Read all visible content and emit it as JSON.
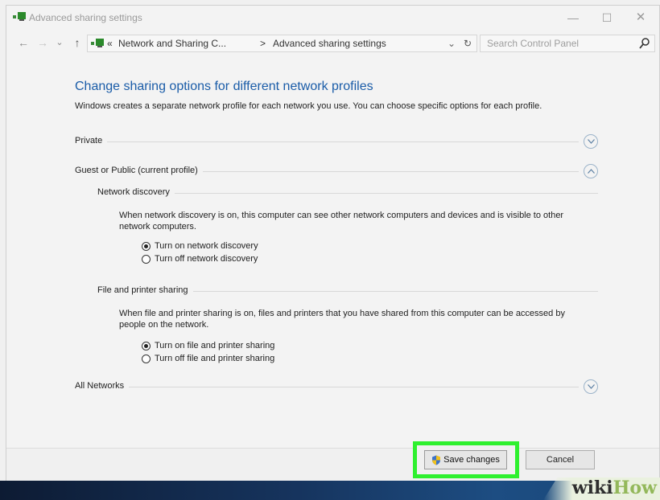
{
  "window": {
    "title": "Advanced sharing settings",
    "controls": {
      "minimize": "—",
      "maximize": "☐",
      "close": "✕"
    }
  },
  "navbar": {
    "back": "←",
    "forward": "→",
    "recent": "⌄",
    "up": "↑",
    "breadcrumb_sep": "«",
    "breadcrumb": [
      "Network and Sharing C...",
      "Advanced sharing settings"
    ],
    "breadcrumb_arrow": ">",
    "dropdown": "⌄",
    "refresh": "↻",
    "search_placeholder": "Search Control Panel"
  },
  "main": {
    "title": "Change sharing options for different network profiles",
    "intro": "Windows creates a separate network profile for each network you use. You can choose specific options for each profile.",
    "profiles": [
      {
        "label": "Private",
        "expanded": false
      },
      {
        "label": "Guest or Public (current profile)",
        "expanded": true
      },
      {
        "label": "All Networks",
        "expanded": false
      }
    ],
    "network_discovery": {
      "heading": "Network discovery",
      "description": "When network discovery is on, this computer can see other network computers and devices and is visible to other network computers.",
      "options": [
        {
          "label": "Turn on network discovery",
          "selected": true
        },
        {
          "label": "Turn off network discovery",
          "selected": false
        }
      ]
    },
    "file_sharing": {
      "heading": "File and printer sharing",
      "description": "When file and printer sharing is on, files and printers that you have shared from this computer can be accessed by people on the network.",
      "options": [
        {
          "label": "Turn on file and printer sharing",
          "selected": true
        },
        {
          "label": "Turn off file and printer sharing",
          "selected": false
        }
      ]
    }
  },
  "footer": {
    "save_label": "Save changes",
    "cancel_label": "Cancel"
  },
  "watermark": {
    "part1": "wiki",
    "part2": "How"
  },
  "colors": {
    "accent": "#1a5ca8",
    "highlight": "#2ef02e"
  }
}
